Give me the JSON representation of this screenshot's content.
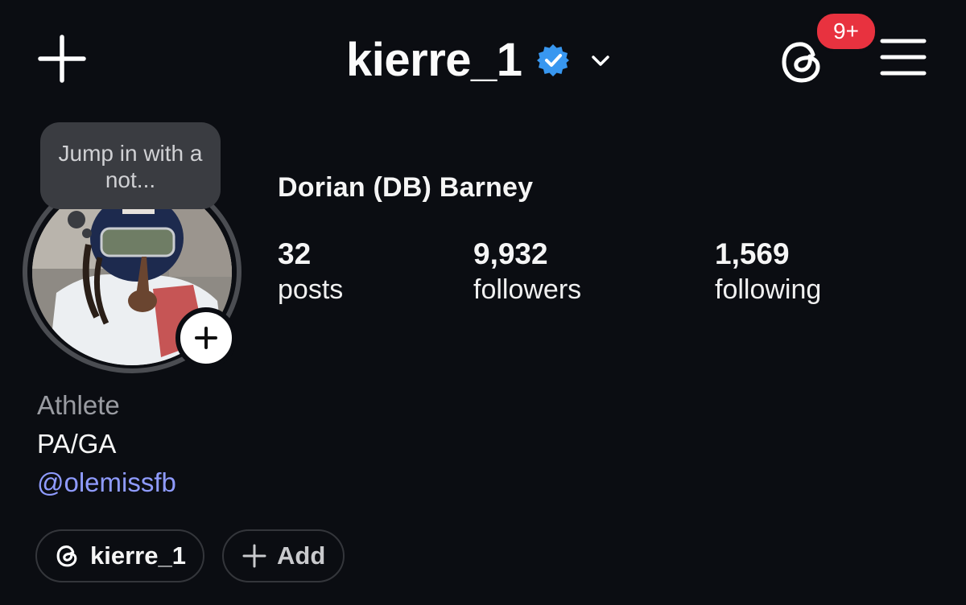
{
  "header": {
    "username": "kierre_1",
    "notification_badge": "9+",
    "icons": {
      "create": "plus-icon",
      "verified": "verified-badge-icon",
      "account_switcher": "chevron-down-icon",
      "threads": "threads-icon",
      "menu": "hamburger-menu-icon"
    }
  },
  "profile": {
    "note_text": "Jump in with a not...",
    "display_name": "Dorian (DB) Barney",
    "stats": [
      {
        "value": "32",
        "label": "posts"
      },
      {
        "value": "9,932",
        "label": "followers"
      },
      {
        "value": "1,569",
        "label": "following"
      }
    ],
    "bio": {
      "category": "Athlete",
      "location": "PA/GA",
      "mention": "@olemissfb"
    },
    "pills": {
      "threads_handle": "kierre_1",
      "add_label": "Add"
    }
  },
  "colors": {
    "background": "#0b0d12",
    "verified_blue": "#3897f0",
    "badge_red": "#e8323f",
    "link_blue": "#8f9bff"
  }
}
